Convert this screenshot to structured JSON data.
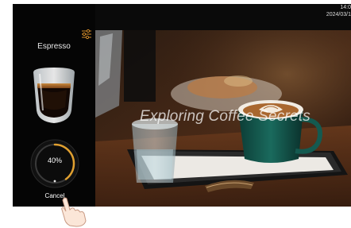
{
  "status_bar": {
    "time": "14:0",
    "date": "2024/03/1"
  },
  "sidebar": {
    "title": "Espresso",
    "progress_percent": 40,
    "progress_label": "40%",
    "cancel_label": "Cancel"
  },
  "hero": {
    "overlay_text": "Exploring Coffee Secrets"
  },
  "colors": {
    "accent": "#e0a030",
    "ring_track": "#4a4a4a",
    "background": "#0a0a0a"
  }
}
